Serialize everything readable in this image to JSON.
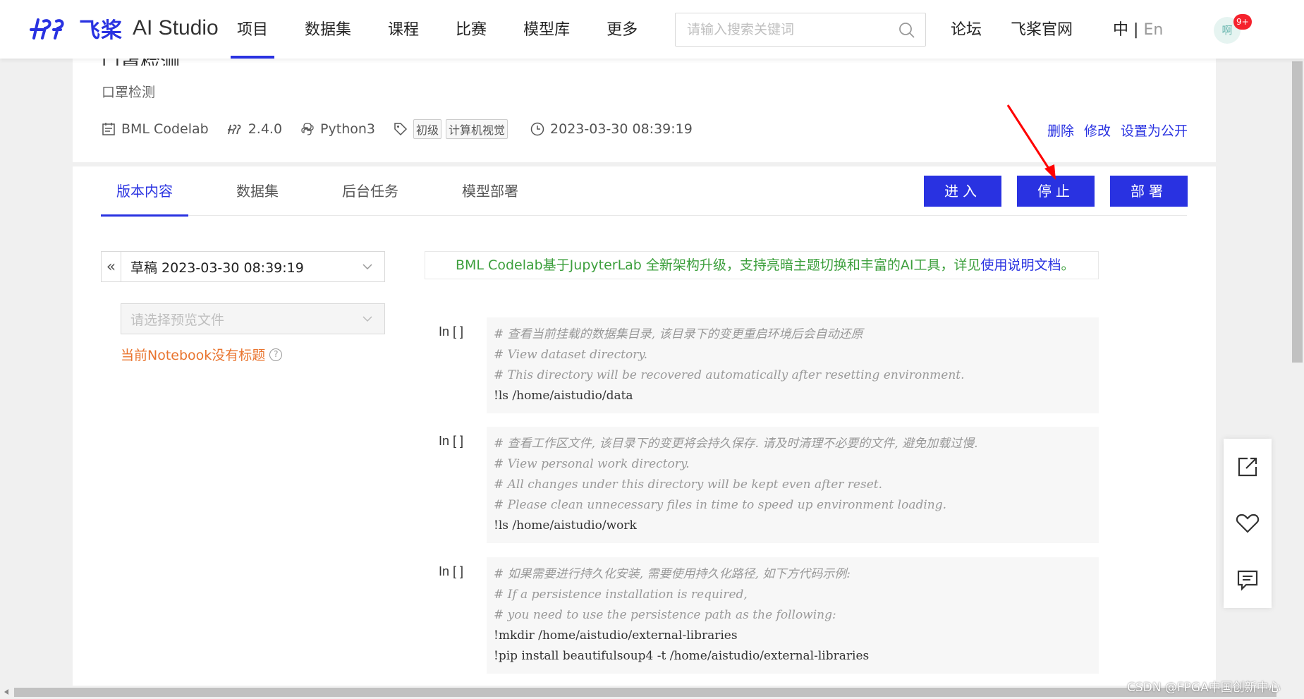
{
  "header": {
    "brand_cn": "飞桨",
    "brand_en": "AI Studio",
    "nav": [
      "项目",
      "数据集",
      "课程",
      "比赛",
      "模型库",
      "更多"
    ],
    "search_placeholder": "请输入搜索关键词",
    "links": [
      "论坛",
      "飞桨官网"
    ],
    "lang_current": "中",
    "lang_sep": "|",
    "lang_other": "En",
    "avatar_text": "啊",
    "badge": "9+"
  },
  "project": {
    "title": "口罩检测",
    "description": "口罩检测",
    "env": "BML Codelab",
    "framework_version": "2.4.0",
    "language": "Python3",
    "tags": [
      "初级",
      "计算机视觉"
    ],
    "created": "2023-03-30 08:39:19",
    "actions": [
      "删除",
      "修改",
      "设置为公开"
    ]
  },
  "tabs": [
    "版本内容",
    "数据集",
    "后台任务",
    "模型部署"
  ],
  "buttons": {
    "enter": "进入",
    "stop": "停止",
    "deploy": "部署"
  },
  "version": {
    "collapse_glyph": "«",
    "selected": "草稿 2023-03-30 08:39:19",
    "file_placeholder": "请选择预览文件",
    "warning": "当前Notebook没有标题",
    "help": "?"
  },
  "banner": {
    "text": "BML Codelab基于JupyterLab 全新架构升级，支持亮暗主题切换和丰富的AI工具，详见",
    "link": "使用说明文档",
    "tail": "。"
  },
  "cells": [
    {
      "label": "In [ ]",
      "comments": [
        "# 查看当前挂载的数据集目录, 该目录下的变更重启环境后会自动还原",
        "# View dataset directory.",
        "# This directory will be recovered automatically after resetting environment."
      ],
      "code": [
        "!ls /home/aistudio/data"
      ]
    },
    {
      "label": "In [ ]",
      "comments": [
        "# 查看工作区文件, 该目录下的变更将会持久保存. 请及时清理不必要的文件, 避免加载过慢.",
        "# View personal work directory.",
        "# All changes under this directory will be kept even after reset.",
        "# Please clean unnecessary files in time to speed up environment loading."
      ],
      "code": [
        "!ls /home/aistudio/work"
      ]
    },
    {
      "label": "In [ ]",
      "comments": [
        "# 如果需要进行持久化安装, 需要使用持久化路径, 如下方代码示例:",
        "# If a persistence installation is required,",
        "# you need to use the persistence path as the following:"
      ],
      "code": [
        "!mkdir /home/aistudio/external-libraries",
        "!pip install beautifulsoup4 -t /home/aistudio/external-libraries"
      ]
    }
  ],
  "watermark": "CSDN @FPGA中国创新中心",
  "colors": {
    "primary": "#2932e1",
    "warning": "#e9742e",
    "banner_green": "#3c9f3c",
    "annotation_red": "#ff0000"
  }
}
